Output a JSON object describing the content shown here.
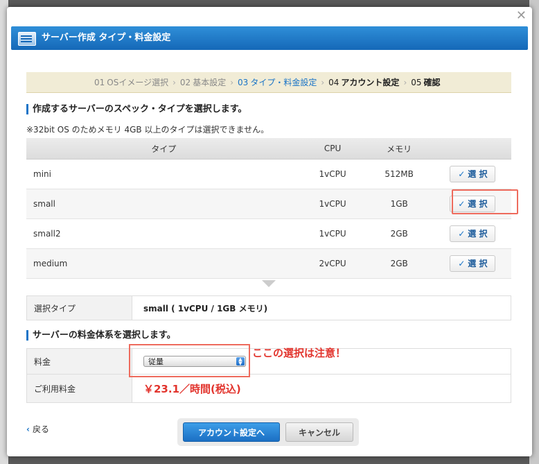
{
  "dialog": {
    "title": "サーバー作成  タイプ・料金設定",
    "close": "✕"
  },
  "steps": [
    {
      "num": "01",
      "label": "OSイメージ選択"
    },
    {
      "num": "02",
      "label": "基本設定"
    },
    {
      "num": "03",
      "label": "タイプ・料金設定"
    },
    {
      "num": "04",
      "label": "アカウント設定"
    },
    {
      "num": "05",
      "label": "確認"
    }
  ],
  "spec_section": {
    "heading": "作成するサーバーのスペック・タイプを選択します。",
    "note": "※32bit OS のためメモリ 4GB 以上のタイプは選択できません。",
    "columns": [
      "タイプ",
      "CPU",
      "メモリ"
    ],
    "rows": [
      {
        "type": "mini",
        "cpu": "1vCPU",
        "memory": "512MB",
        "button": "選 択"
      },
      {
        "type": "small",
        "cpu": "1vCPU",
        "memory": "1GB",
        "button": "選 択"
      },
      {
        "type": "small2",
        "cpu": "1vCPU",
        "memory": "2GB",
        "button": "選 択"
      },
      {
        "type": "medium",
        "cpu": "2vCPU",
        "memory": "2GB",
        "button": "選 択"
      }
    ]
  },
  "selected": {
    "label": "選択タイプ",
    "value": "small ( 1vCPU / 1GB メモリ)"
  },
  "fee_section": {
    "heading": "サーバーの料金体系を選択します。",
    "fee_label": "料金",
    "fee_value": "従量",
    "usage_label": "ご利用料金",
    "usage_value": "￥23.1／時間(税込)",
    "annotation": "ここの選択は注意！"
  },
  "footer": {
    "back": "戻る",
    "next": "アカウント設定へ",
    "cancel": "キャンセル"
  },
  "colors": {
    "accent": "#1a74c7",
    "highlight": "#ee6b5d",
    "price": "#e2342d"
  }
}
